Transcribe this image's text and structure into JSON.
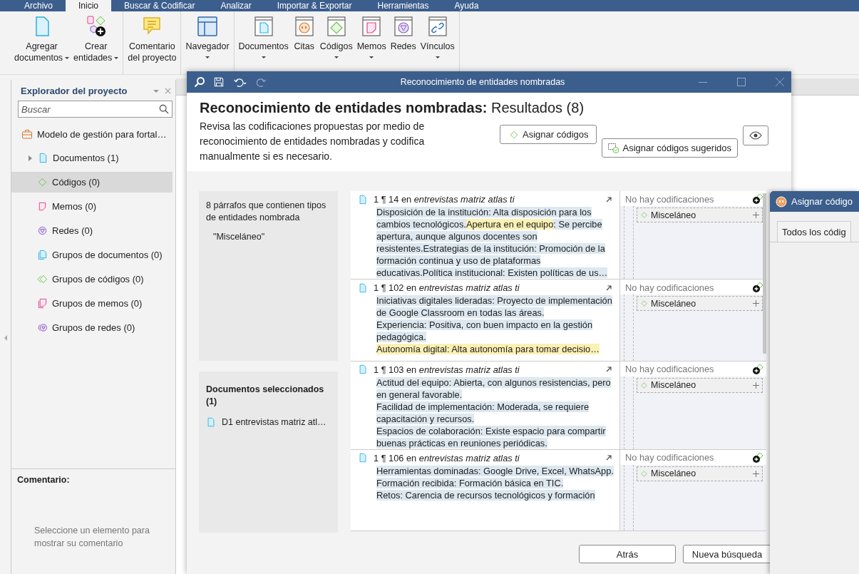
{
  "menu_tabs": [
    {
      "label": "Archivo",
      "selected": false
    },
    {
      "label": "Inicio",
      "selected": true
    },
    {
      "label": "Buscar & Codificar",
      "selected": false
    },
    {
      "label": "Analizar",
      "selected": false
    },
    {
      "label": "Importar & Exportar",
      "selected": false
    },
    {
      "label": "Herramientas",
      "selected": false
    },
    {
      "label": "Ayuda",
      "selected": false
    }
  ],
  "ribbon": [
    {
      "buttons": [
        {
          "kind": "add-document",
          "lines": [
            "Agregar",
            "documentos"
          ],
          "dropdown": true
        },
        {
          "kind": "create-entities",
          "lines": [
            "Crear",
            "entidades"
          ],
          "dropdown": true
        }
      ]
    },
    {
      "buttons": [
        {
          "kind": "comment",
          "lines": [
            "Comentario",
            "del proyecto"
          ],
          "dropdown": false
        }
      ]
    },
    {
      "buttons": [
        {
          "kind": "navigator",
          "lines": [
            "Navegador"
          ],
          "dropdown": true
        }
      ]
    },
    {
      "buttons": [
        {
          "kind": "documents",
          "lines": [
            "Documentos"
          ],
          "dropdown": true
        },
        {
          "kind": "quotes",
          "lines": [
            "Citas"
          ],
          "dropdown": false
        },
        {
          "kind": "codes",
          "lines": [
            "Códigos"
          ],
          "dropdown": true
        },
        {
          "kind": "memos",
          "lines": [
            "Memos"
          ],
          "dropdown": true
        },
        {
          "kind": "networks",
          "lines": [
            "Redes"
          ],
          "dropdown": false
        },
        {
          "kind": "links",
          "lines": [
            "Vínculos"
          ],
          "dropdown": true
        }
      ]
    }
  ],
  "explorer": {
    "title": "Explorador del proyecto",
    "search": {
      "placeholder": "Buscar"
    },
    "project": "Modelo de gestión para fortal…",
    "items": [
      {
        "kind": "documents",
        "label": "Documentos (1)",
        "expandable": true,
        "selected": false
      },
      {
        "kind": "codes",
        "label": "Códigos (0)",
        "expandable": false,
        "selected": true
      },
      {
        "kind": "memos",
        "label": "Memos (0)",
        "expandable": false,
        "selected": false
      },
      {
        "kind": "networks",
        "label": "Redes (0)",
        "expandable": false,
        "selected": false
      },
      {
        "kind": "document-groups",
        "label": "Grupos de documentos (0)",
        "expandable": false,
        "selected": false
      },
      {
        "kind": "code-groups",
        "label": "Grupos de códigos (0)",
        "expandable": false,
        "selected": false
      },
      {
        "kind": "memo-groups",
        "label": "Grupos de memos (0)",
        "expandable": false,
        "selected": false
      },
      {
        "kind": "network-groups",
        "label": "Grupos de redes (0)",
        "expandable": false,
        "selected": false
      }
    ],
    "comment": {
      "title": "Comentario:",
      "hint": "Seleccione un elemento para mostrar su comentario"
    }
  },
  "dialog": {
    "title": "Reconocimiento de entidades nombradas",
    "heading": "**Reconocimiento de entidades nombradas:** Resultados (8)",
    "description": "Revisa las codificaciones propuestas por medio de reconocimiento de entidades nombradas y codifica manualmente si es necesario.",
    "assign_button": "Asignar códigos",
    "assign_suggested_button": "Asignar códigos sugeridos",
    "summary": {
      "text": "8 párrafos que contienen tipos de entidades nombrada",
      "entity": "\"Misceláneo\""
    },
    "selected_documents": {
      "title": "Documentos seleccionados (1)",
      "document": "D1 entrevistas matriz atl…"
    },
    "results": [
      {
        "reference": "1 ¶ 14 en *entrevistas matriz atlas ti*",
        "paragraphs": [
          [
            {
              "text": "Disposición de la institución: Alta disposición para los cambios tecnológicos.",
              "match": false
            },
            {
              "text": "Apertura en el equipo",
              "match": true
            },
            {
              "text": ": Se percibe apertura, aunque algunos docentes son resistentes.Estrategias de la institución: Promoción de la formación continua y uso de plataformas educativas.Política institucional: Existen políticas de us…",
              "match": false
            }
          ]
        ],
        "status": "No hay codificaciones",
        "code": "Misceláneo"
      },
      {
        "reference": "1 ¶ 102 en *entrevistas matriz atlas ti*",
        "paragraphs": [
          [
            {
              "text": "Iniciativas digitales lideradas: Proyecto de implementación de Google Classroom en todas las áreas.",
              "match": false
            }
          ],
          [
            {
              "text": "Experiencia: Positiva, con buen impacto en la gestión pedagógica.",
              "match": false
            }
          ],
          [
            {
              "text": "Autonomía digital: Alta autonomía para tomar decisio…",
              "match": true
            }
          ]
        ],
        "status": "No hay codificaciones",
        "code": "Misceláneo"
      },
      {
        "reference": "1 ¶ 103 en *entrevistas matriz atlas ti*",
        "paragraphs": [
          [
            {
              "text": "Actitud del equipo: Abierta, con algunos resistencias, pero en general favorable.",
              "match": false
            }
          ],
          [
            {
              "text": "Facilidad de implementación: Moderada, se requiere capacitación y recursos.",
              "match": false
            }
          ],
          [
            {
              "text": "Espacios de colaboración: Existe espacio para compartir buenas prácticas en reuniones periódicas.",
              "match": false
            }
          ]
        ],
        "status": "No hay codificaciones",
        "code": "Misceláneo"
      },
      {
        "reference": "1 ¶ 106 en *entrevistas matriz atlas ti*",
        "paragraphs": [
          [
            {
              "text": "Herramientas dominadas: Google Drive, Excel, WhatsApp.",
              "match": false
            }
          ],
          [
            {
              "text": "Formación recibida: Formación básica en TIC.",
              "match": false
            }
          ],
          [
            {
              "text": "Retos: Carencia de recursos tecnológicos y formación",
              "match": false
            }
          ]
        ],
        "status": "No hay codificaciones",
        "code": "Misceláneo"
      }
    ],
    "footer_buttons": [
      "Atrás",
      "Nueva búsqueda"
    ]
  },
  "side_window": {
    "title": "Asignar código",
    "tab": "Todos los códig"
  }
}
